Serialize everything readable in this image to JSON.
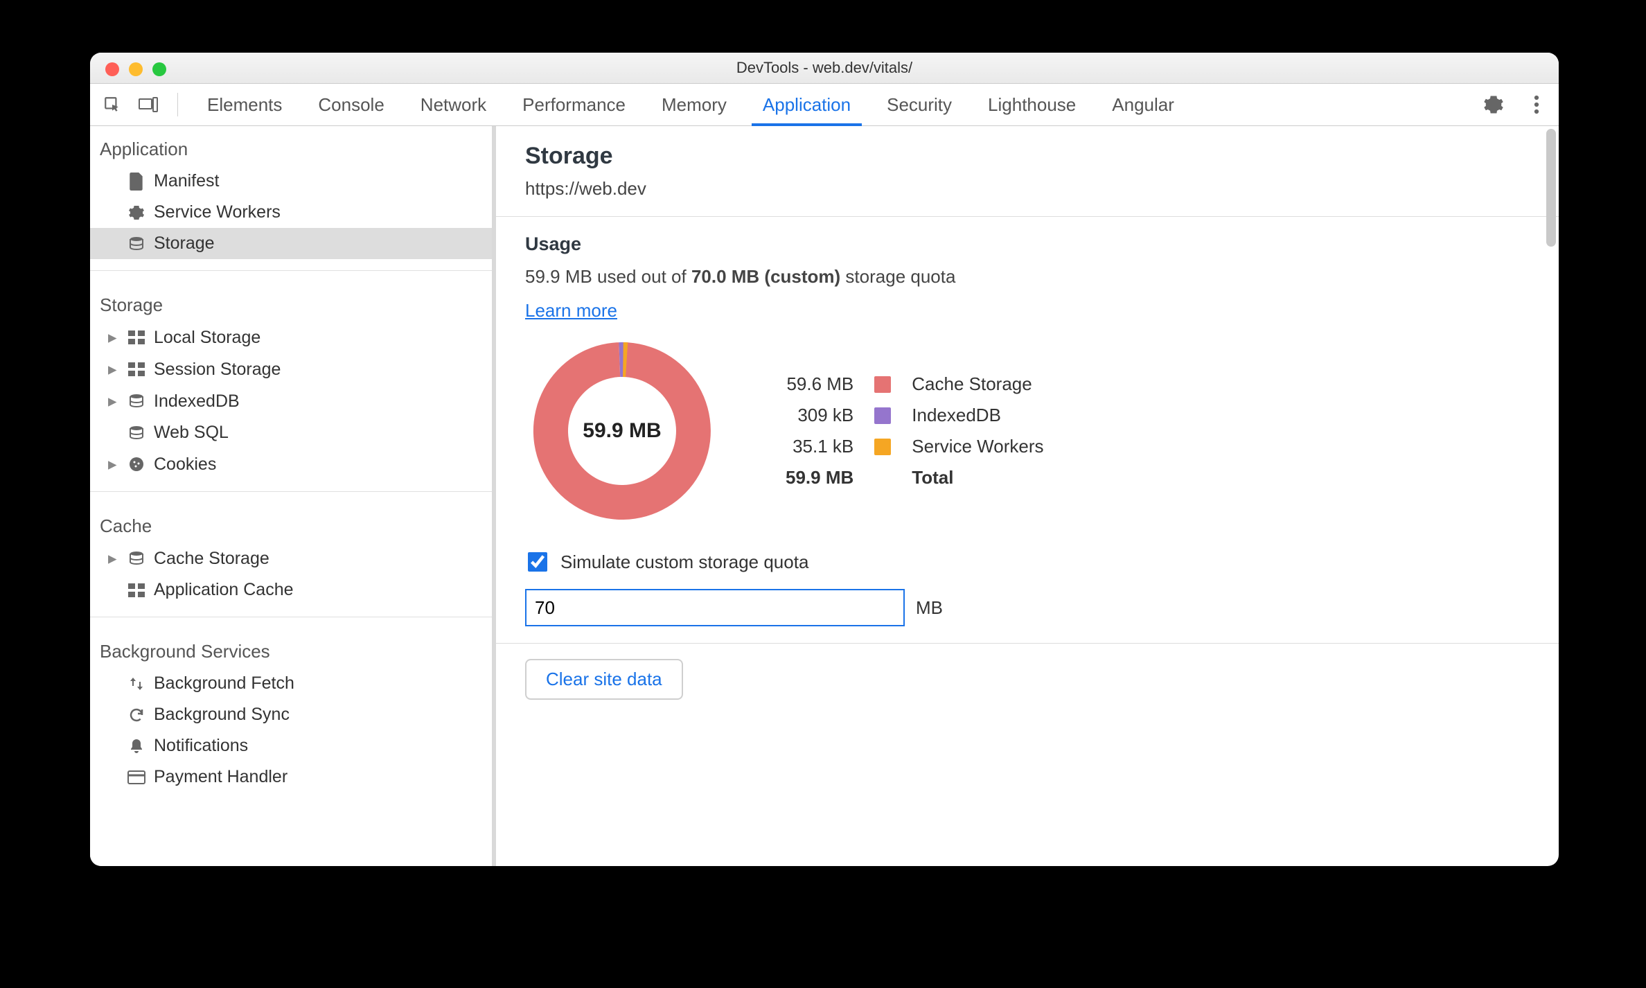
{
  "window_title": "DevTools - web.dev/vitals/",
  "tabs": [
    "Elements",
    "Console",
    "Network",
    "Performance",
    "Memory",
    "Application",
    "Security",
    "Lighthouse",
    "Angular"
  ],
  "active_tab": "Application",
  "sidebar": {
    "groups": [
      {
        "title": "Application",
        "items": [
          {
            "label": "Manifest",
            "icon": "file",
            "expandable": false
          },
          {
            "label": "Service Workers",
            "icon": "gear",
            "expandable": false
          },
          {
            "label": "Storage",
            "icon": "db",
            "expandable": false,
            "selected": true
          }
        ]
      },
      {
        "title": "Storage",
        "items": [
          {
            "label": "Local Storage",
            "icon": "grid",
            "expandable": true
          },
          {
            "label": "Session Storage",
            "icon": "grid",
            "expandable": true
          },
          {
            "label": "IndexedDB",
            "icon": "db",
            "expandable": true
          },
          {
            "label": "Web SQL",
            "icon": "db",
            "expandable": false
          },
          {
            "label": "Cookies",
            "icon": "cookie",
            "expandable": true
          }
        ]
      },
      {
        "title": "Cache",
        "items": [
          {
            "label": "Cache Storage",
            "icon": "db",
            "expandable": true
          },
          {
            "label": "Application Cache",
            "icon": "grid",
            "expandable": false
          }
        ]
      },
      {
        "title": "Background Services",
        "items": [
          {
            "label": "Background Fetch",
            "icon": "updown",
            "expandable": false
          },
          {
            "label": "Background Sync",
            "icon": "sync",
            "expandable": false
          },
          {
            "label": "Notifications",
            "icon": "bell",
            "expandable": false
          },
          {
            "label": "Payment Handler",
            "icon": "card",
            "expandable": false
          }
        ]
      }
    ]
  },
  "main": {
    "heading": "Storage",
    "origin": "https://web.dev",
    "usage_heading": "Usage",
    "usage_pre": "59.9 MB used out of ",
    "usage_bold": "70.0 MB (custom)",
    "usage_post": " storage quota",
    "learn_more": "Learn more",
    "donut_center": "59.9 MB",
    "legend": [
      {
        "size": "59.6 MB",
        "label": "Cache Storage",
        "color": "#e57373"
      },
      {
        "size": "309 kB",
        "label": "IndexedDB",
        "color": "#9575cd"
      },
      {
        "size": "35.1 kB",
        "label": "Service Workers",
        "color": "#f5a623"
      }
    ],
    "legend_total_size": "59.9 MB",
    "legend_total_label": "Total",
    "simulate_label": "Simulate custom storage quota",
    "simulate_checked": true,
    "quota_value": "70",
    "quota_unit": "MB",
    "clear_button": "Clear site data"
  },
  "chart_data": {
    "type": "pie",
    "title": "Storage usage breakdown",
    "series": [
      {
        "name": "Cache Storage",
        "value_mb": 59.6,
        "color": "#e57373"
      },
      {
        "name": "IndexedDB",
        "value_mb": 0.309,
        "color": "#9575cd"
      },
      {
        "name": "Service Workers",
        "value_mb": 0.0351,
        "color": "#f5a623"
      }
    ],
    "total_mb": 59.9,
    "quota_mb": 70.0
  }
}
